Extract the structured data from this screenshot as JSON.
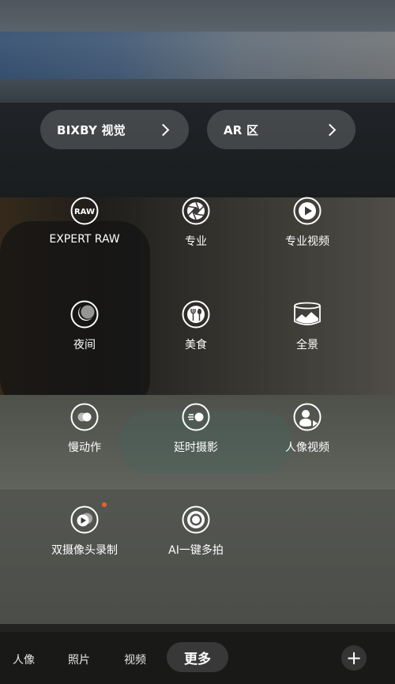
{
  "quick_links": [
    {
      "label": "BIXBY 视觉",
      "icon": "chevron-right-icon"
    },
    {
      "label": "AR 区",
      "icon": "chevron-right-icon"
    }
  ],
  "modes": [
    {
      "label": "EXPERT RAW",
      "icon": "raw-icon"
    },
    {
      "label": "专业",
      "icon": "aperture-icon"
    },
    {
      "label": "专业视频",
      "icon": "pro-video-icon"
    },
    {
      "label": "夜间",
      "icon": "moon-icon"
    },
    {
      "label": "美食",
      "icon": "fork-spoon-icon"
    },
    {
      "label": "全景",
      "icon": "panorama-icon"
    },
    {
      "label": "慢动作",
      "icon": "slow-motion-icon"
    },
    {
      "label": "延时摄影",
      "icon": "hyperlapse-icon"
    },
    {
      "label": "人像视频",
      "icon": "portrait-video-icon"
    },
    {
      "label": "双摄像头录制",
      "icon": "dual-recording-icon",
      "badge": "new-dot"
    },
    {
      "label": "AI一键多拍",
      "icon": "single-take-icon"
    }
  ],
  "icon_text": {
    "raw": "RAW"
  },
  "bottom_tabs": [
    {
      "label": "人像"
    },
    {
      "label": "照片"
    },
    {
      "label": "视频"
    },
    {
      "label": "更多",
      "active": true
    }
  ],
  "add_button": {
    "icon": "plus-icon",
    "label": "+"
  },
  "colors": {
    "badge": "#e8632b",
    "pill_bg": "rgba(255,255,255,0.17)"
  }
}
